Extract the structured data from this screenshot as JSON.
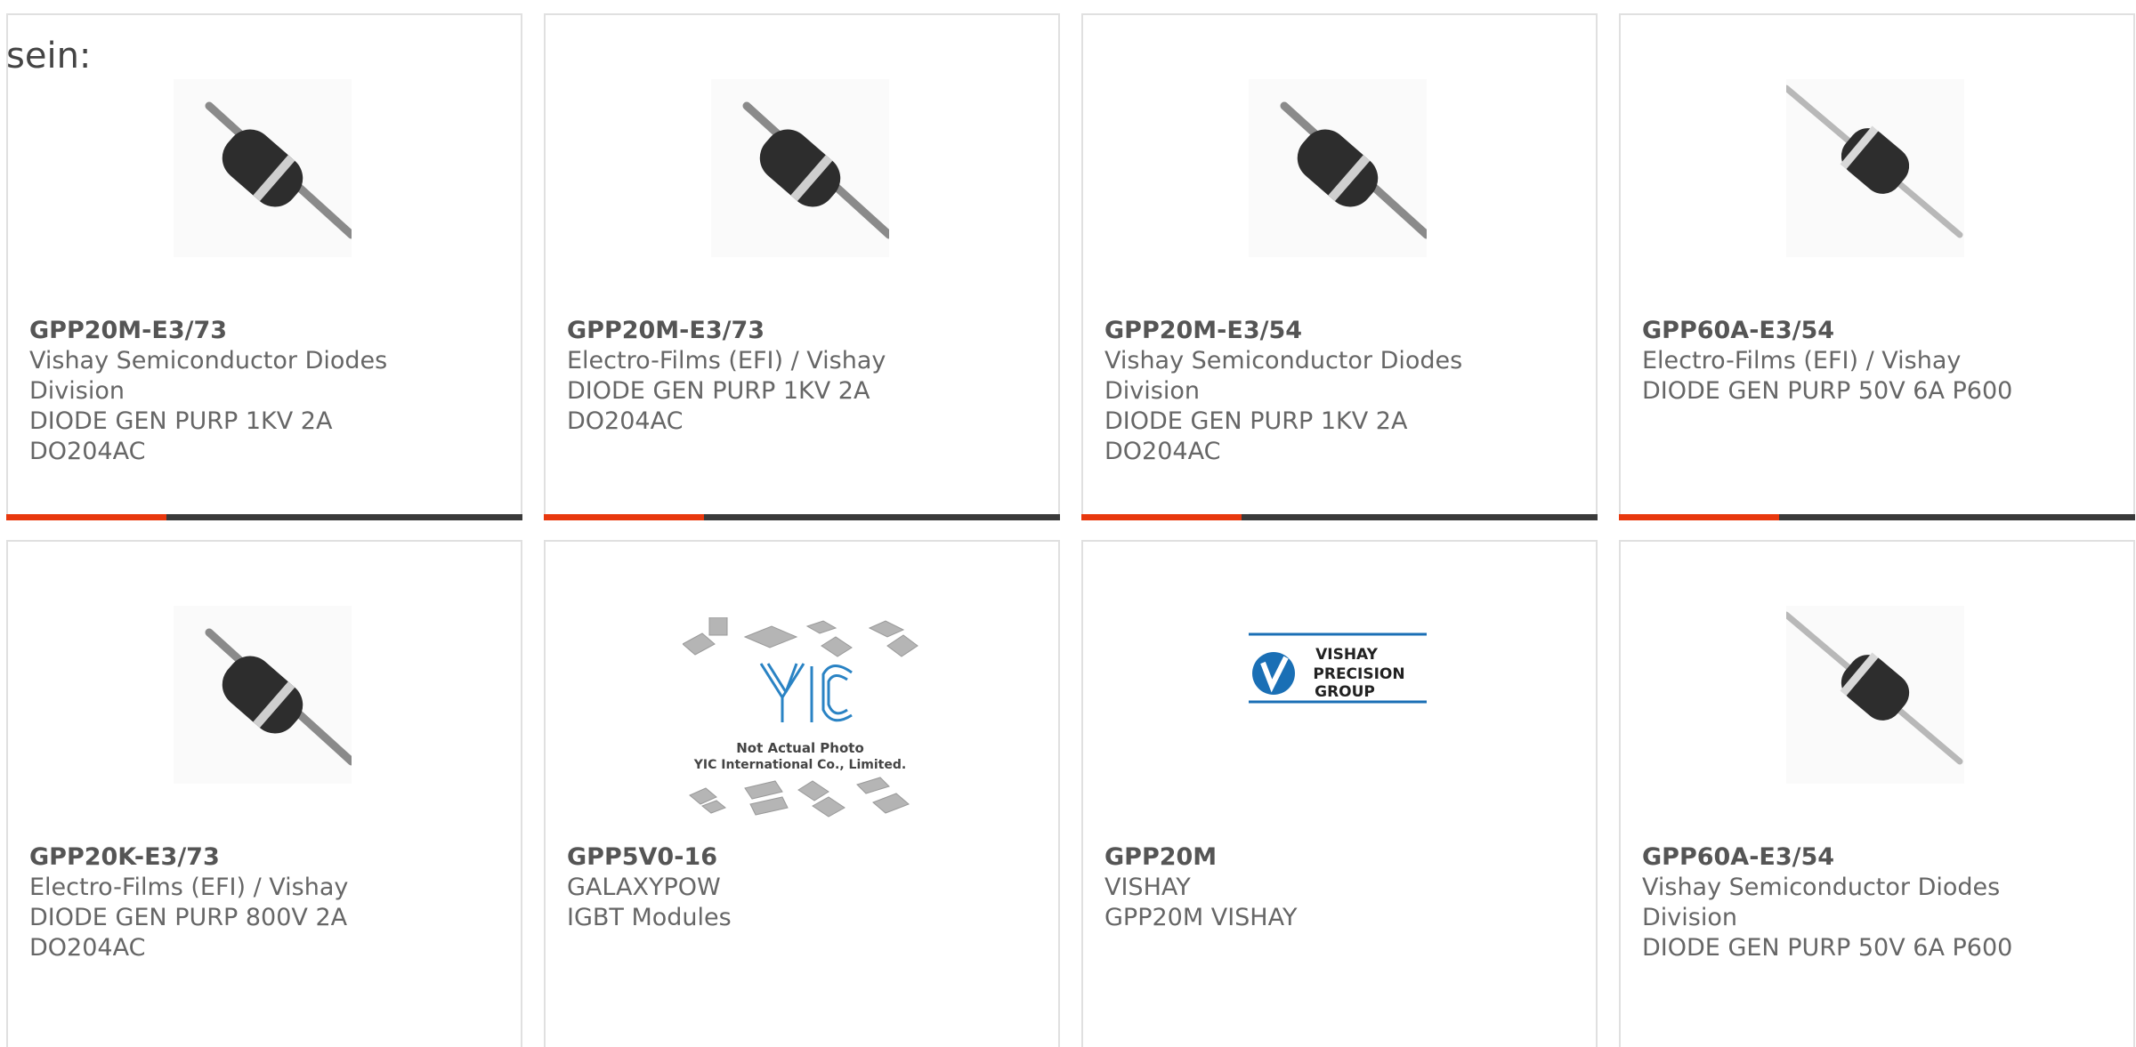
{
  "fragment_text": "sein:",
  "colors": {
    "accent": "#e8380e",
    "bar": "#3a3a3a",
    "border": "#e0e0e0"
  },
  "products": [
    {
      "part": "GPP20M-E3/73",
      "maker_lines": [
        "Vishay Semiconductor Diodes",
        "Division"
      ],
      "desc_lines": [
        "DIODE GEN PURP 1KV 2A",
        "DO204AC"
      ],
      "image": "axial-diode-tilted",
      "progress": 0.31
    },
    {
      "part": "GPP20M-E3/73",
      "maker_lines": [
        "Electro-Films (EFI) / Vishay"
      ],
      "desc_lines": [
        "DIODE GEN PURP 1KV 2A",
        "DO204AC"
      ],
      "image": "axial-diode-tilted",
      "progress": 0.31
    },
    {
      "part": "GPP20M-E3/54",
      "maker_lines": [
        "Vishay Semiconductor Diodes",
        "Division"
      ],
      "desc_lines": [
        "DIODE GEN PURP 1KV 2A",
        "DO204AC"
      ],
      "image": "axial-diode-tilted",
      "progress": 0.31
    },
    {
      "part": "GPP60A-E3/54",
      "maker_lines": [
        "Electro-Films (EFI) / Vishay"
      ],
      "desc_lines": [
        "DIODE GEN PURP 50V 6A P600"
      ],
      "image": "axial-diode-steep",
      "progress": 0.31
    },
    {
      "part": "GPP20K-E3/73",
      "maker_lines": [
        "Electro-Films (EFI) / Vishay"
      ],
      "desc_lines": [
        "DIODE GEN PURP 800V 2A",
        "DO204AC"
      ],
      "image": "axial-diode-tilted"
    },
    {
      "part": "GPP5V0-16",
      "maker_lines": [
        "GALAXYPOW"
      ],
      "desc_lines": [
        "IGBT Modules"
      ],
      "image": "yic-placeholder",
      "image_text": [
        "Not Actual Photo",
        "YIC International Co., Limited."
      ]
    },
    {
      "part": "GPP20M",
      "maker_lines": [
        "VISHAY"
      ],
      "desc_lines": [
        "GPP20M VISHAY"
      ],
      "image": "vishay-precision-logo",
      "logo_text": [
        "VISHAY",
        "PRECISION",
        "GROUP"
      ]
    },
    {
      "part": "GPP60A-E3/54",
      "maker_lines": [
        "Vishay Semiconductor Diodes",
        "Division"
      ],
      "desc_lines": [
        "DIODE GEN PURP 50V 6A P600"
      ],
      "image": "axial-diode-steep"
    }
  ]
}
